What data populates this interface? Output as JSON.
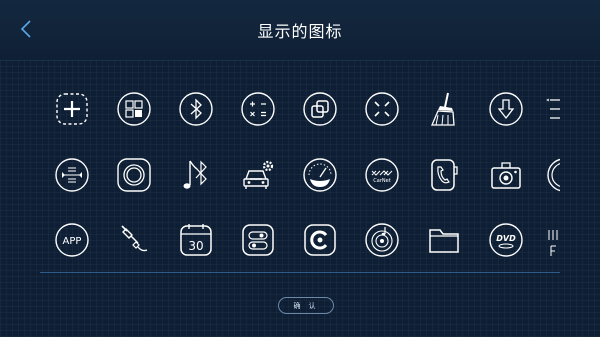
{
  "header": {
    "title": "显示的图标",
    "back_icon": "chevron-left-icon"
  },
  "icons": {
    "row1": [
      "add-icon",
      "grid-icon",
      "bluetooth-icon",
      "calculator-icon",
      "copy-icon",
      "close-cross-icon",
      "broom-icon",
      "download-icon",
      "menu-icon"
    ],
    "row2": [
      "equalizer-icon",
      "ring-icon",
      "bluetooth-music-icon",
      "car-settings-icon",
      "speedometer-icon",
      "carnet-icon",
      "phone-icon",
      "camera-icon",
      "partial-circle-icon"
    ],
    "row3": [
      "app-icon",
      "aux-cable-icon",
      "calendar-icon",
      "toggle-switch-icon",
      "carlife-icon",
      "music-disc-icon",
      "folder-icon",
      "dvd-icon",
      "partial-text-icon"
    ]
  },
  "labels": {
    "app": "APP",
    "calendar_day": "30",
    "carnet": "CarNet",
    "dvd": "DVD"
  },
  "footer": {
    "confirm_label": "确 认"
  },
  "colors": {
    "background": "#0e1f35",
    "accent_line": "#2b5b86",
    "icon_stroke": "#ffffff"
  }
}
